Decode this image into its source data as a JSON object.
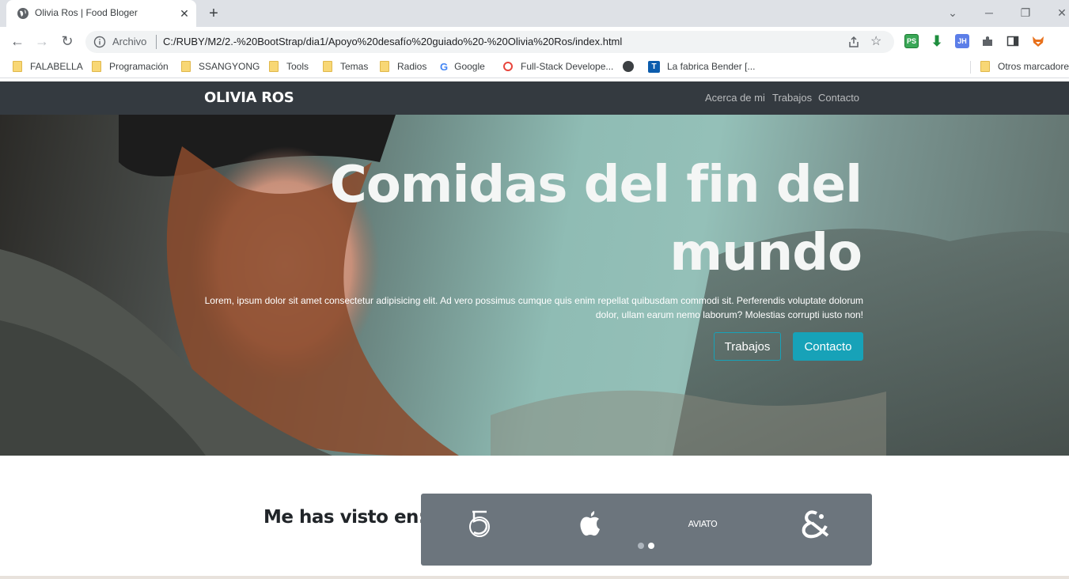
{
  "browser": {
    "tab_title": "Olivia Ros | Food Bloger",
    "tab_close": "✕",
    "new_tab": "+",
    "url_scheme_label": "Archivo",
    "url": "C:/RUBY/M2/2.-%20BootStrap/dia1/Apoyo%20desafío%20guiado%20-%20Olivia%20Ros/index.html",
    "extensions": [
      "PS",
      "JH"
    ],
    "bookmarks": [
      {
        "label": "FALABELLA",
        "icon": "folder-icon"
      },
      {
        "label": "Programación",
        "icon": "folder-icon"
      },
      {
        "label": "SSANGYONG",
        "icon": "folder-icon"
      },
      {
        "label": "Tools",
        "icon": "folder-icon"
      },
      {
        "label": "Temas",
        "icon": "folder-icon"
      },
      {
        "label": "Radios",
        "icon": "folder-icon"
      },
      {
        "label": "Google",
        "icon": "google-icon"
      },
      {
        "label": "Full-Stack Develope...",
        "icon": "site-icon"
      },
      {
        "label": "",
        "icon": "globe-icon"
      },
      {
        "label": "La fabrica Bender [...",
        "icon": "trello-icon"
      }
    ],
    "other_bookmarks": "Otros marcadores"
  },
  "site": {
    "brand": "OLIVIA ROS",
    "nav": [
      "Acerca de mi",
      "Trabajos",
      "Contacto"
    ],
    "hero": {
      "headline": "Comidas del fin del mundo",
      "lead": "Lorem, ipsum dolor sit amet consectetur adipisicing elit. Ad vero possimus cumque quis enim repellat quibusdam commodi sit. Perferendis voluptate dolorum dolor, ullam earum nemo laborum? Molestias corrupti iusto non!",
      "btn_outline": "Trabajos",
      "btn_solid": "Contacto"
    },
    "seen_title": "Me has visto en:",
    "logos": [
      "500-logo",
      "apple-logo",
      "aviato-logo",
      "dnd-logo"
    ],
    "logo_aviato_text": "AVIATO",
    "carousel_active_index": 1
  },
  "colors": {
    "navbar": "#343a40",
    "accent": "#17a2b8",
    "logos_box": "#6c757d"
  }
}
